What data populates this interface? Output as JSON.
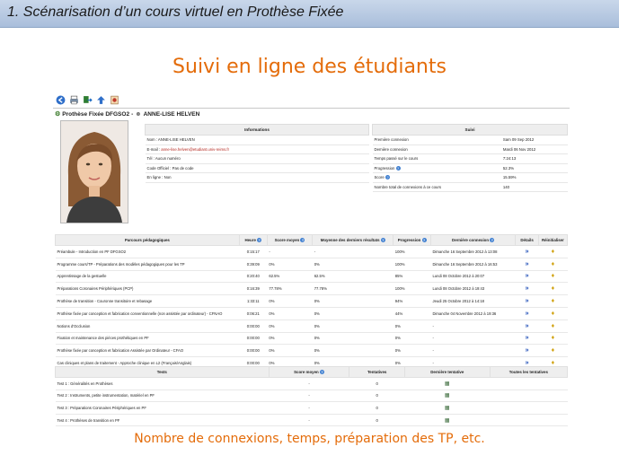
{
  "slide": {
    "header": "1. Scénarisation d’un cours virtuel en Prothèse Fixée",
    "title": "Suivi en ligne des étudiants",
    "footer": "Nombre de connexions, temps, préparation des TP, etc."
  },
  "toolbar": {
    "icons": [
      "back-icon",
      "print-icon",
      "export-icon",
      "up-icon",
      "report-icon"
    ]
  },
  "course": {
    "name": "Prothèse Fixée DFGSO2",
    "separator": "-",
    "student": "ANNE-LISE HELVEN"
  },
  "info": {
    "heading": "Informations",
    "rows": [
      {
        "label": "Nom : ANNE-LISE HELVEN",
        "link": ""
      },
      {
        "label": "E-mail : ",
        "link": "anne-lise.helven@etudiant.univ-reims.fr"
      },
      {
        "label": "Tél : Aucun numéro",
        "link": ""
      },
      {
        "label": "Code Officiel : Pas de code",
        "link": ""
      },
      {
        "label": "En ligne : Non",
        "link": ""
      }
    ]
  },
  "suivi": {
    "heading": "Suivi",
    "rows": [
      {
        "label": "Première connexion",
        "value": "Sam 09 Sep 2012"
      },
      {
        "label": "Dernière connexion",
        "value": "Mardi 06 Nov 2012"
      },
      {
        "label": "Temps passé sur le cours",
        "value": "7:24:13"
      },
      {
        "label": "Progression",
        "value": "52.3%"
      },
      {
        "label": "Score",
        "value": "15.59%"
      },
      {
        "label": "Nombre total de connexions à ce cours",
        "value": "140"
      }
    ]
  },
  "parcours": {
    "headers": [
      "Parcours pédagogiques",
      "Heure",
      "Score moyen",
      "Moyenne des derniers résultats",
      "Progression",
      "Dernière connexion",
      "Détails",
      "Réinitialiser"
    ],
    "rows": [
      [
        "Préambule - Introduction en PF DFGSO2",
        "0:15:17",
        "-",
        "-",
        "100%",
        "Dimanche 16 Septembre 2012 à 13:08"
      ],
      [
        "Programme cours/TP - Préparations des modèles pédagogiques pour les TP",
        "0:39:09",
        "0%",
        "0%",
        "100%",
        "Dimanche 16 Septembre 2012 à 16:53"
      ],
      [
        "Apprentissage de la gestuelle",
        "0:20:40",
        "62.5%",
        "62.5%",
        "85%",
        "Lundi 08 Octobre 2012 à 20:07"
      ],
      [
        "Préparations Coronaires Périphériques (PCP)",
        "0:16:39",
        "77.78%",
        "77.78%",
        "100%",
        "Lundi 08 Octobre 2012 à 19:43"
      ],
      [
        "Prothèse de transition - Couronne transitoire et rebasage",
        "1:33:11",
        "0%",
        "0%",
        "94%",
        "Jeudi 25 Octobre 2012 à 14:18"
      ],
      [
        "Prothèse fixée par conception et fabrication conventionnelle (non assistée par ordinateur) - CFNAO",
        "0:06:21",
        "0%",
        "0%",
        "44%",
        "Dimanche 04 Novembre 2012 à 19:36"
      ],
      [
        "Notions d'Occlusion",
        "0:00:00",
        "0%",
        "0%",
        "0%",
        "-"
      ],
      [
        "Fixation et maintenance des pièces prothétiques en PF",
        "0:00:00",
        "0%",
        "0%",
        "0%",
        "-"
      ],
      [
        "Prothèse fixée par conception et fabrication Assistée par Ordinateur - CFAO",
        "0:00:00",
        "0%",
        "0%",
        "0%",
        "-"
      ],
      [
        "Cas cliniques et plans de traitement - Approche clinique en L2 (Français/Anglais)",
        "0:00:00",
        "0%",
        "0%",
        "0%",
        "-"
      ]
    ]
  },
  "tests": {
    "headers": [
      "Tests",
      "Score moyen",
      "Tentatives",
      "Dernière tentative",
      "Toutes les tentatives"
    ],
    "rows": [
      [
        "Test 1 : Généralités en Prothèses",
        "-",
        "0"
      ],
      [
        "Test 2 : Instruments, petite instrumentation, matériel en PF",
        "-",
        "0"
      ],
      [
        "Test 3 : Préparations Coronaires Périphériques en PF",
        "-",
        "0"
      ],
      [
        "Test 4 : Prothèses de transition en PF",
        "-",
        "0"
      ]
    ]
  },
  "colors": {
    "accent": "#e46c0a",
    "header_bg": "#b7c9e2",
    "link": "#b3261e"
  }
}
